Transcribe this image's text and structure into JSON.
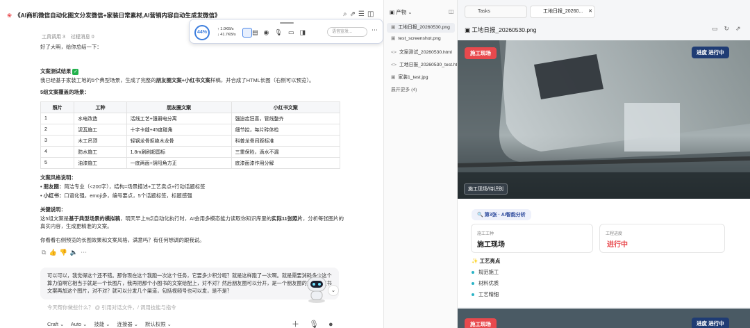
{
  "chat": {
    "title": "《AI商机微信自动化图文分发微信+家装日常素材,AI营销内容自动生成发微信》",
    "tabs": [
      "工具调用 3",
      "过程消息 0"
    ],
    "greeting": "好了大明，给你总结一下：",
    "section_title": "文案测试结果",
    "summary_prefix": "我已经基于家装工地的5个典型场景，生成了完整的",
    "summary_bold": "朋友圈文案+小红书文案",
    "summary_suffix": "样稿，并合成了HTML长图（右侧可以预览）。",
    "scenes_title": "5组文案覆盖的场景：",
    "table": {
      "headers": [
        "照片",
        "工种",
        "朋友圈文案",
        "小红书文案"
      ],
      "rows": [
        [
          "1",
          "水电改造",
          "活线工艺+强弱电分离",
          "强迫症狂喜，管线整齐"
        ],
        [
          "2",
          "泥瓦施工",
          "十字卡缝+45度碰角",
          "细节控，每片砖体检"
        ],
        [
          "3",
          "木工吊顶",
          "轻钢龙骨拒绝木龙骨",
          "科普龙骨间距标准"
        ],
        [
          "4",
          "防水施工",
          "1.8m涮刷超国标",
          "三重保险，滴水不漏"
        ],
        [
          "5",
          "油漆施工",
          "一底两面+阴阳角方正",
          "底漆面漆作用分解"
        ]
      ]
    },
    "style_title": "文案风格说明：",
    "style_items": [
      {
        "label": "朋友圈：",
        "text": "简洁专业（<200字），结构=场景描述+工艺卖点+行动话题标签"
      },
      {
        "label": "小红书：",
        "text": "口语化强，emoji多，编号要点，5个话题标签，标题感强"
      }
    ],
    "key_title": "关键说明：",
    "key_prefix": "这5组文案是",
    "key_bold1": "基于典型场景的模拟稿",
    "key_mid": "，明天早上9点自动化执行时，AI会用多模态能力读取你知识库里的",
    "key_bold2": "实际11张照片",
    "key_suffix": "，分析每张图片的真实内容，生成更精准的文案。",
    "closing": "你看看右侧预览的长图效果和文案风格，满意吗？有任何想调的跟我说。",
    "user_message": "可以可以，我觉得这个还不错。那你现在这个我跑一次这个任务，它要多少积分呢？就是这样跑了一次啊。就是需要消耗多少这个算力值啊它相当于就是一个长图片，我再把那个小图书的文案给配上，对不对？然后朋友圈可以分开，是一个朋友圈的文，小红书文案再加这个图片，对不对？就可以分发几个渠道，包括视频号也可以发，是不是？",
    "input_placeholder": "今天帮你做些什么？ @ 引用对话文件，/ 调用技能与指令",
    "bottom_tools": [
      "Craft ⌄",
      "Auto ⌄",
      "技能 ⌄",
      "连接器 ⌄",
      "默认权限 ⌄"
    ]
  },
  "float_toolbar": {
    "percent": "44%",
    "up": "↑ 1.0KB/s",
    "down": "↓ 41.7KB/s",
    "search_placeholder": "语音宣发..."
  },
  "artifacts": {
    "header": "产物",
    "files": [
      {
        "name": "工地日报_20260530.png",
        "icon": "▣"
      },
      {
        "name": "test_screenshot.png",
        "icon": "▣"
      },
      {
        "name": "文案测试_20260530.html",
        "icon": "<>"
      },
      {
        "name": "工地日报_20260530_test.html",
        "icon": "<>"
      },
      {
        "name": "家装1_test.jpg",
        "icon": "▣"
      }
    ],
    "more": "展开更多 (4)"
  },
  "preview": {
    "tabs": [
      "Tasks",
      "工地日报_20260..."
    ],
    "file_title": "工地日报_20260530.png",
    "badge_left": "施工现场",
    "badge_right": "进度 进行中",
    "photo_tag": "施工现场/待识别",
    "ai_tag": "第3张 · AI智能分析",
    "field1_label": "施工工种",
    "field1_value": "施工现场",
    "field2_label": "工程进度",
    "field2_value": "进行中",
    "highlights_title": "工艺亮点",
    "highlights": [
      "规范施工",
      "材料优质",
      "工艺精细"
    ]
  }
}
